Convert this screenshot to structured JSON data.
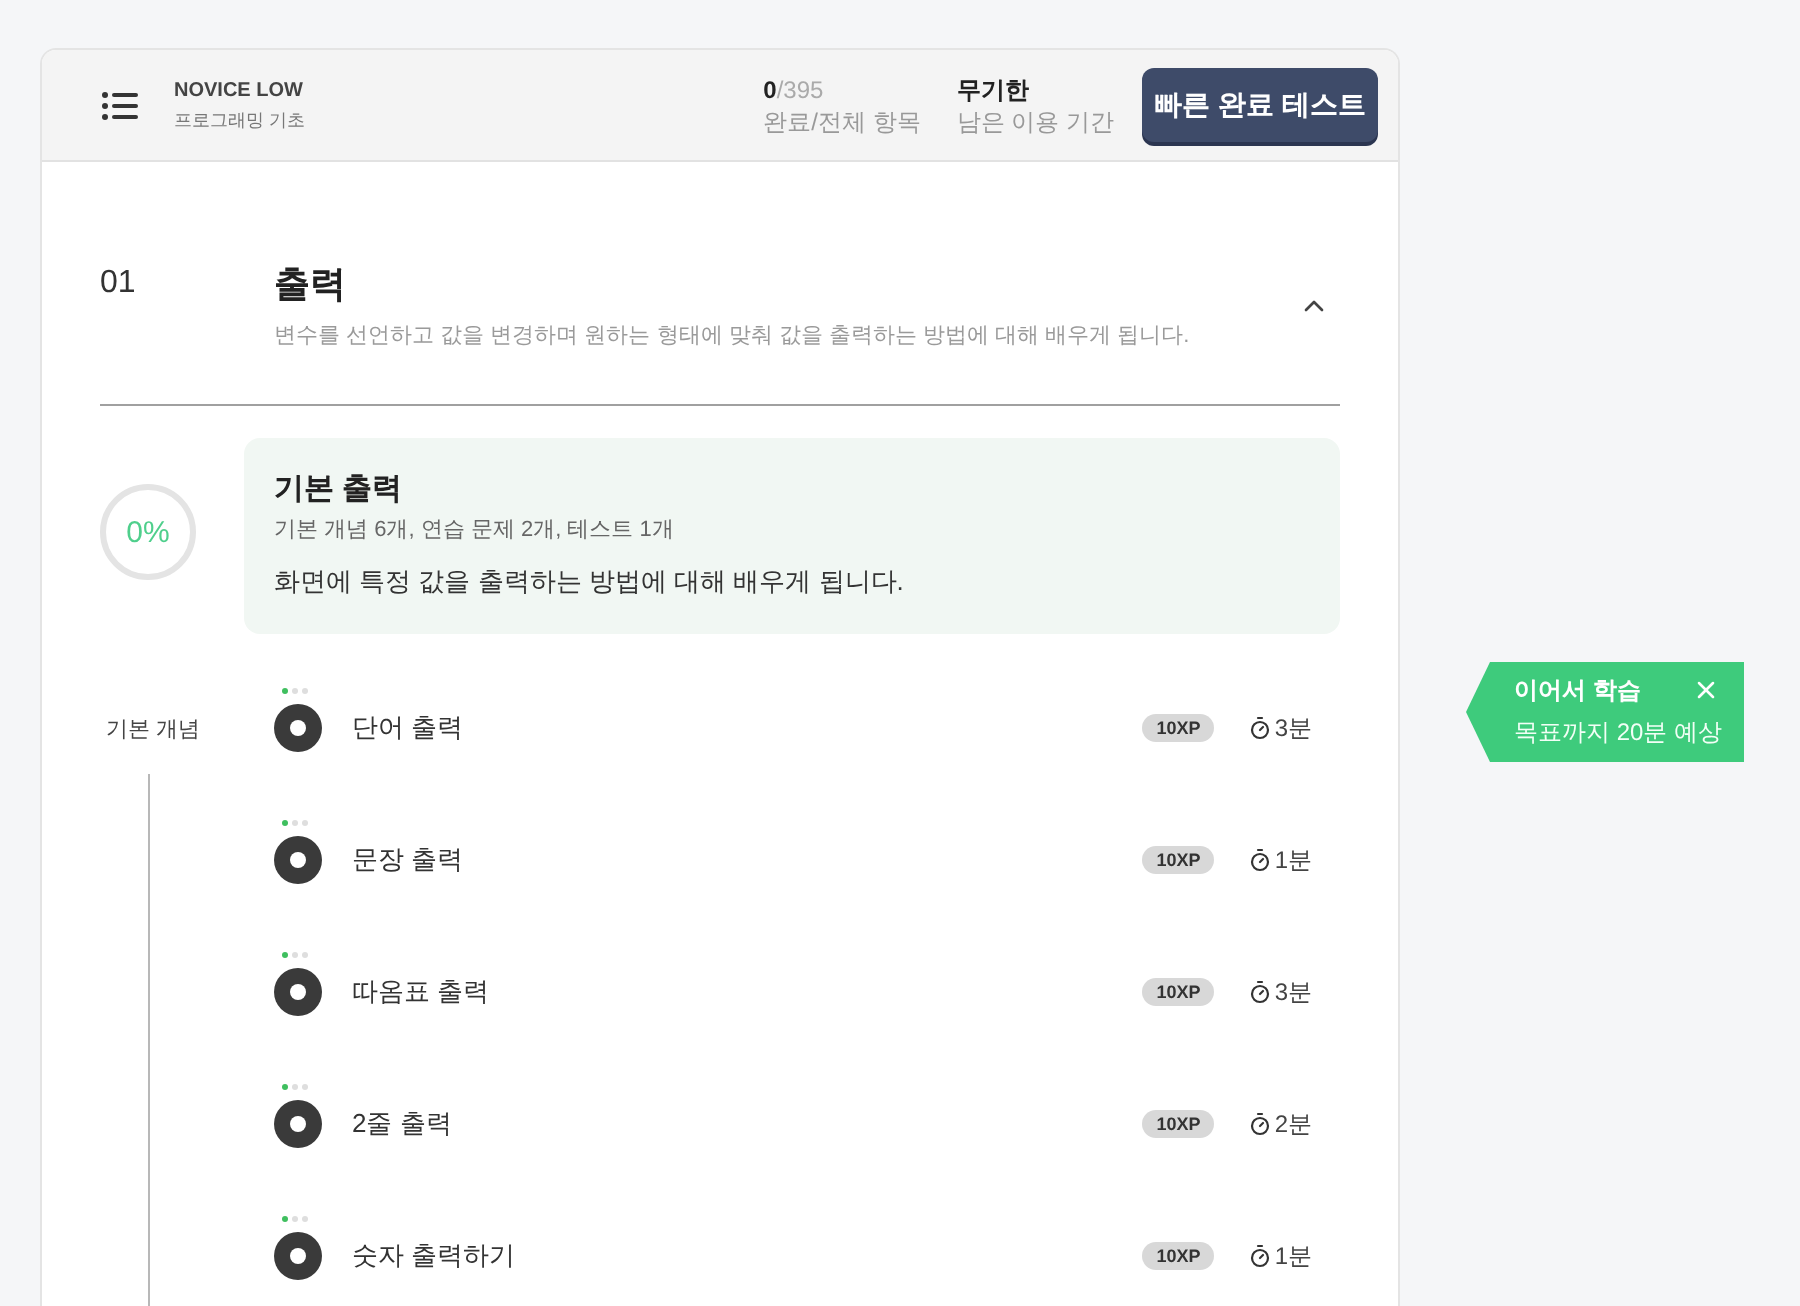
{
  "header": {
    "course_level": "NOVICE LOW",
    "course_name": "프로그래밍 기초",
    "progress": {
      "done": "0",
      "total": "/395",
      "label": "완료/전체 항목"
    },
    "period": {
      "value": "무기한",
      "label": "남은 이용 기간"
    },
    "button": "빠른 완료 테스트"
  },
  "sections": [
    {
      "number": "01",
      "title": "출력",
      "description": "변수를 선언하고 값을 변경하며 원하는 형태에 맞춰 값을 출력하는 방법에 대해 배우게 됩니다.",
      "expanded": true,
      "lessons": [
        {
          "progress": "0%",
          "title": "기본 출력",
          "summary": "기본 개념 6개, 연습 문제 2개, 테스트 1개",
          "description": "화면에 특정 값을 출력하는 방법에 대해 배우게 됩니다.",
          "groups": [
            {
              "label": "기본 개념",
              "items": [
                {
                  "title": "단어 출력",
                  "steps": [
                    {
                      "done": true
                    },
                    {
                      "done": false
                    },
                    {
                      "done": false
                    }
                  ],
                  "xp": "10XP",
                  "duration": "3분"
                },
                {
                  "title": "문장 출력",
                  "steps": [
                    {
                      "done": true
                    },
                    {
                      "done": false
                    },
                    {
                      "done": false
                    }
                  ],
                  "xp": "10XP",
                  "duration": "1분"
                },
                {
                  "title": "따옴표 출력",
                  "steps": [
                    {
                      "done": true
                    },
                    {
                      "done": false
                    },
                    {
                      "done": false
                    }
                  ],
                  "xp": "10XP",
                  "duration": "3분"
                },
                {
                  "title": "2줄 출력",
                  "steps": [
                    {
                      "done": true
                    },
                    {
                      "done": false
                    },
                    {
                      "done": false
                    }
                  ],
                  "xp": "10XP",
                  "duration": "2분"
                },
                {
                  "title": "숫자 출력하기",
                  "steps": [
                    {
                      "done": true
                    },
                    {
                      "done": false
                    },
                    {
                      "done": false
                    }
                  ],
                  "xp": "10XP",
                  "duration": "1분"
                }
              ]
            }
          ]
        }
      ]
    }
  ],
  "toast": {
    "title": "이어서 학습",
    "message": "목표까지 20분 예상"
  }
}
